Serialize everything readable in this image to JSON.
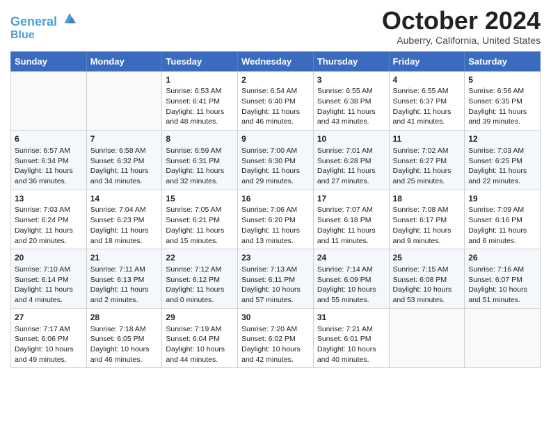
{
  "header": {
    "logo_line1": "General",
    "logo_line2": "Blue",
    "month": "October 2024",
    "location": "Auberry, California, United States"
  },
  "weekdays": [
    "Sunday",
    "Monday",
    "Tuesday",
    "Wednesday",
    "Thursday",
    "Friday",
    "Saturday"
  ],
  "weeks": [
    [
      {
        "day": "",
        "sunrise": "",
        "sunset": "",
        "daylight": ""
      },
      {
        "day": "",
        "sunrise": "",
        "sunset": "",
        "daylight": ""
      },
      {
        "day": "1",
        "sunrise": "Sunrise: 6:53 AM",
        "sunset": "Sunset: 6:41 PM",
        "daylight": "Daylight: 11 hours and 48 minutes."
      },
      {
        "day": "2",
        "sunrise": "Sunrise: 6:54 AM",
        "sunset": "Sunset: 6:40 PM",
        "daylight": "Daylight: 11 hours and 46 minutes."
      },
      {
        "day": "3",
        "sunrise": "Sunrise: 6:55 AM",
        "sunset": "Sunset: 6:38 PM",
        "daylight": "Daylight: 11 hours and 43 minutes."
      },
      {
        "day": "4",
        "sunrise": "Sunrise: 6:55 AM",
        "sunset": "Sunset: 6:37 PM",
        "daylight": "Daylight: 11 hours and 41 minutes."
      },
      {
        "day": "5",
        "sunrise": "Sunrise: 6:56 AM",
        "sunset": "Sunset: 6:35 PM",
        "daylight": "Daylight: 11 hours and 39 minutes."
      }
    ],
    [
      {
        "day": "6",
        "sunrise": "Sunrise: 6:57 AM",
        "sunset": "Sunset: 6:34 PM",
        "daylight": "Daylight: 11 hours and 36 minutes."
      },
      {
        "day": "7",
        "sunrise": "Sunrise: 6:58 AM",
        "sunset": "Sunset: 6:32 PM",
        "daylight": "Daylight: 11 hours and 34 minutes."
      },
      {
        "day": "8",
        "sunrise": "Sunrise: 6:59 AM",
        "sunset": "Sunset: 6:31 PM",
        "daylight": "Daylight: 11 hours and 32 minutes."
      },
      {
        "day": "9",
        "sunrise": "Sunrise: 7:00 AM",
        "sunset": "Sunset: 6:30 PM",
        "daylight": "Daylight: 11 hours and 29 minutes."
      },
      {
        "day": "10",
        "sunrise": "Sunrise: 7:01 AM",
        "sunset": "Sunset: 6:28 PM",
        "daylight": "Daylight: 11 hours and 27 minutes."
      },
      {
        "day": "11",
        "sunrise": "Sunrise: 7:02 AM",
        "sunset": "Sunset: 6:27 PM",
        "daylight": "Daylight: 11 hours and 25 minutes."
      },
      {
        "day": "12",
        "sunrise": "Sunrise: 7:03 AM",
        "sunset": "Sunset: 6:25 PM",
        "daylight": "Daylight: 11 hours and 22 minutes."
      }
    ],
    [
      {
        "day": "13",
        "sunrise": "Sunrise: 7:03 AM",
        "sunset": "Sunset: 6:24 PM",
        "daylight": "Daylight: 11 hours and 20 minutes."
      },
      {
        "day": "14",
        "sunrise": "Sunrise: 7:04 AM",
        "sunset": "Sunset: 6:23 PM",
        "daylight": "Daylight: 11 hours and 18 minutes."
      },
      {
        "day": "15",
        "sunrise": "Sunrise: 7:05 AM",
        "sunset": "Sunset: 6:21 PM",
        "daylight": "Daylight: 11 hours and 15 minutes."
      },
      {
        "day": "16",
        "sunrise": "Sunrise: 7:06 AM",
        "sunset": "Sunset: 6:20 PM",
        "daylight": "Daylight: 11 hours and 13 minutes."
      },
      {
        "day": "17",
        "sunrise": "Sunrise: 7:07 AM",
        "sunset": "Sunset: 6:18 PM",
        "daylight": "Daylight: 11 hours and 11 minutes."
      },
      {
        "day": "18",
        "sunrise": "Sunrise: 7:08 AM",
        "sunset": "Sunset: 6:17 PM",
        "daylight": "Daylight: 11 hours and 9 minutes."
      },
      {
        "day": "19",
        "sunrise": "Sunrise: 7:09 AM",
        "sunset": "Sunset: 6:16 PM",
        "daylight": "Daylight: 11 hours and 6 minutes."
      }
    ],
    [
      {
        "day": "20",
        "sunrise": "Sunrise: 7:10 AM",
        "sunset": "Sunset: 6:14 PM",
        "daylight": "Daylight: 11 hours and 4 minutes."
      },
      {
        "day": "21",
        "sunrise": "Sunrise: 7:11 AM",
        "sunset": "Sunset: 6:13 PM",
        "daylight": "Daylight: 11 hours and 2 minutes."
      },
      {
        "day": "22",
        "sunrise": "Sunrise: 7:12 AM",
        "sunset": "Sunset: 6:12 PM",
        "daylight": "Daylight: 11 hours and 0 minutes."
      },
      {
        "day": "23",
        "sunrise": "Sunrise: 7:13 AM",
        "sunset": "Sunset: 6:11 PM",
        "daylight": "Daylight: 10 hours and 57 minutes."
      },
      {
        "day": "24",
        "sunrise": "Sunrise: 7:14 AM",
        "sunset": "Sunset: 6:09 PM",
        "daylight": "Daylight: 10 hours and 55 minutes."
      },
      {
        "day": "25",
        "sunrise": "Sunrise: 7:15 AM",
        "sunset": "Sunset: 6:08 PM",
        "daylight": "Daylight: 10 hours and 53 minutes."
      },
      {
        "day": "26",
        "sunrise": "Sunrise: 7:16 AM",
        "sunset": "Sunset: 6:07 PM",
        "daylight": "Daylight: 10 hours and 51 minutes."
      }
    ],
    [
      {
        "day": "27",
        "sunrise": "Sunrise: 7:17 AM",
        "sunset": "Sunset: 6:06 PM",
        "daylight": "Daylight: 10 hours and 49 minutes."
      },
      {
        "day": "28",
        "sunrise": "Sunrise: 7:18 AM",
        "sunset": "Sunset: 6:05 PM",
        "daylight": "Daylight: 10 hours and 46 minutes."
      },
      {
        "day": "29",
        "sunrise": "Sunrise: 7:19 AM",
        "sunset": "Sunset: 6:04 PM",
        "daylight": "Daylight: 10 hours and 44 minutes."
      },
      {
        "day": "30",
        "sunrise": "Sunrise: 7:20 AM",
        "sunset": "Sunset: 6:02 PM",
        "daylight": "Daylight: 10 hours and 42 minutes."
      },
      {
        "day": "31",
        "sunrise": "Sunrise: 7:21 AM",
        "sunset": "Sunset: 6:01 PM",
        "daylight": "Daylight: 10 hours and 40 minutes."
      },
      {
        "day": "",
        "sunrise": "",
        "sunset": "",
        "daylight": ""
      },
      {
        "day": "",
        "sunrise": "",
        "sunset": "",
        "daylight": ""
      }
    ]
  ]
}
